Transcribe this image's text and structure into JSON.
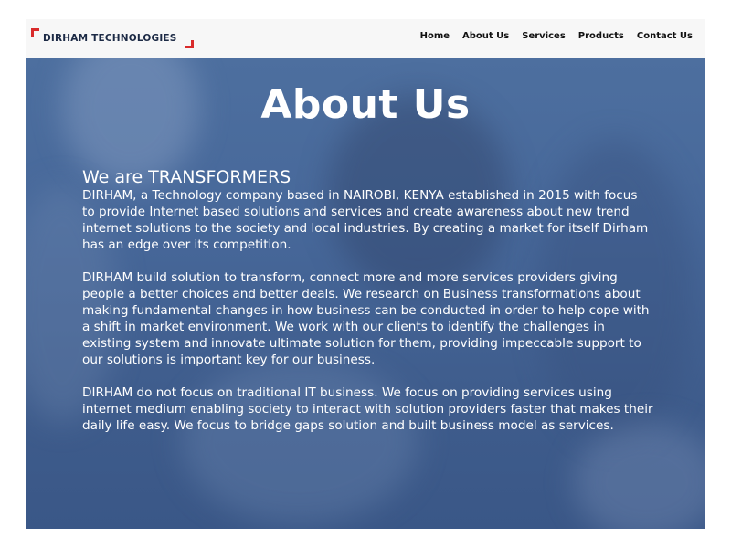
{
  "brand": {
    "name": "DIRHAM TECHNOLOGIES",
    "accent_color": "#d92b2b",
    "text_color": "#1c2a45"
  },
  "nav": {
    "items": [
      {
        "label": "Home"
      },
      {
        "label": "About Us"
      },
      {
        "label": "Services"
      },
      {
        "label": "Products"
      },
      {
        "label": "Contact Us"
      }
    ]
  },
  "hero": {
    "title": "About Us",
    "overlay_color": "#45679a",
    "subtitle": "We are TRANSFORMERS",
    "paragraphs": [
      "DIRHAM, a Technology company based in NAIROBI, KENYA established in 2015 with focus to provide Internet based solutions and services and create awareness about new trend internet solutions to the society and local industries. By creating a market for itself Dirham has an edge over its competition.",
      "DIRHAM build solution to transform, connect more and more services providers giving people a better choices and better deals. We research on Business transformations about making fundamental changes in how business can be conducted in order to help cope with a shift in market environment. We work with our clients to identify the challenges in existing system and innovate ultimate solution for them, providing impeccable support to our solutions is important key for our business.",
      "DIRHAM do not focus on traditional IT business. We focus on providing services using internet medium enabling society to interact with solution providers faster that makes their daily life easy. We focus to bridge gaps solution and built business model as services."
    ]
  }
}
